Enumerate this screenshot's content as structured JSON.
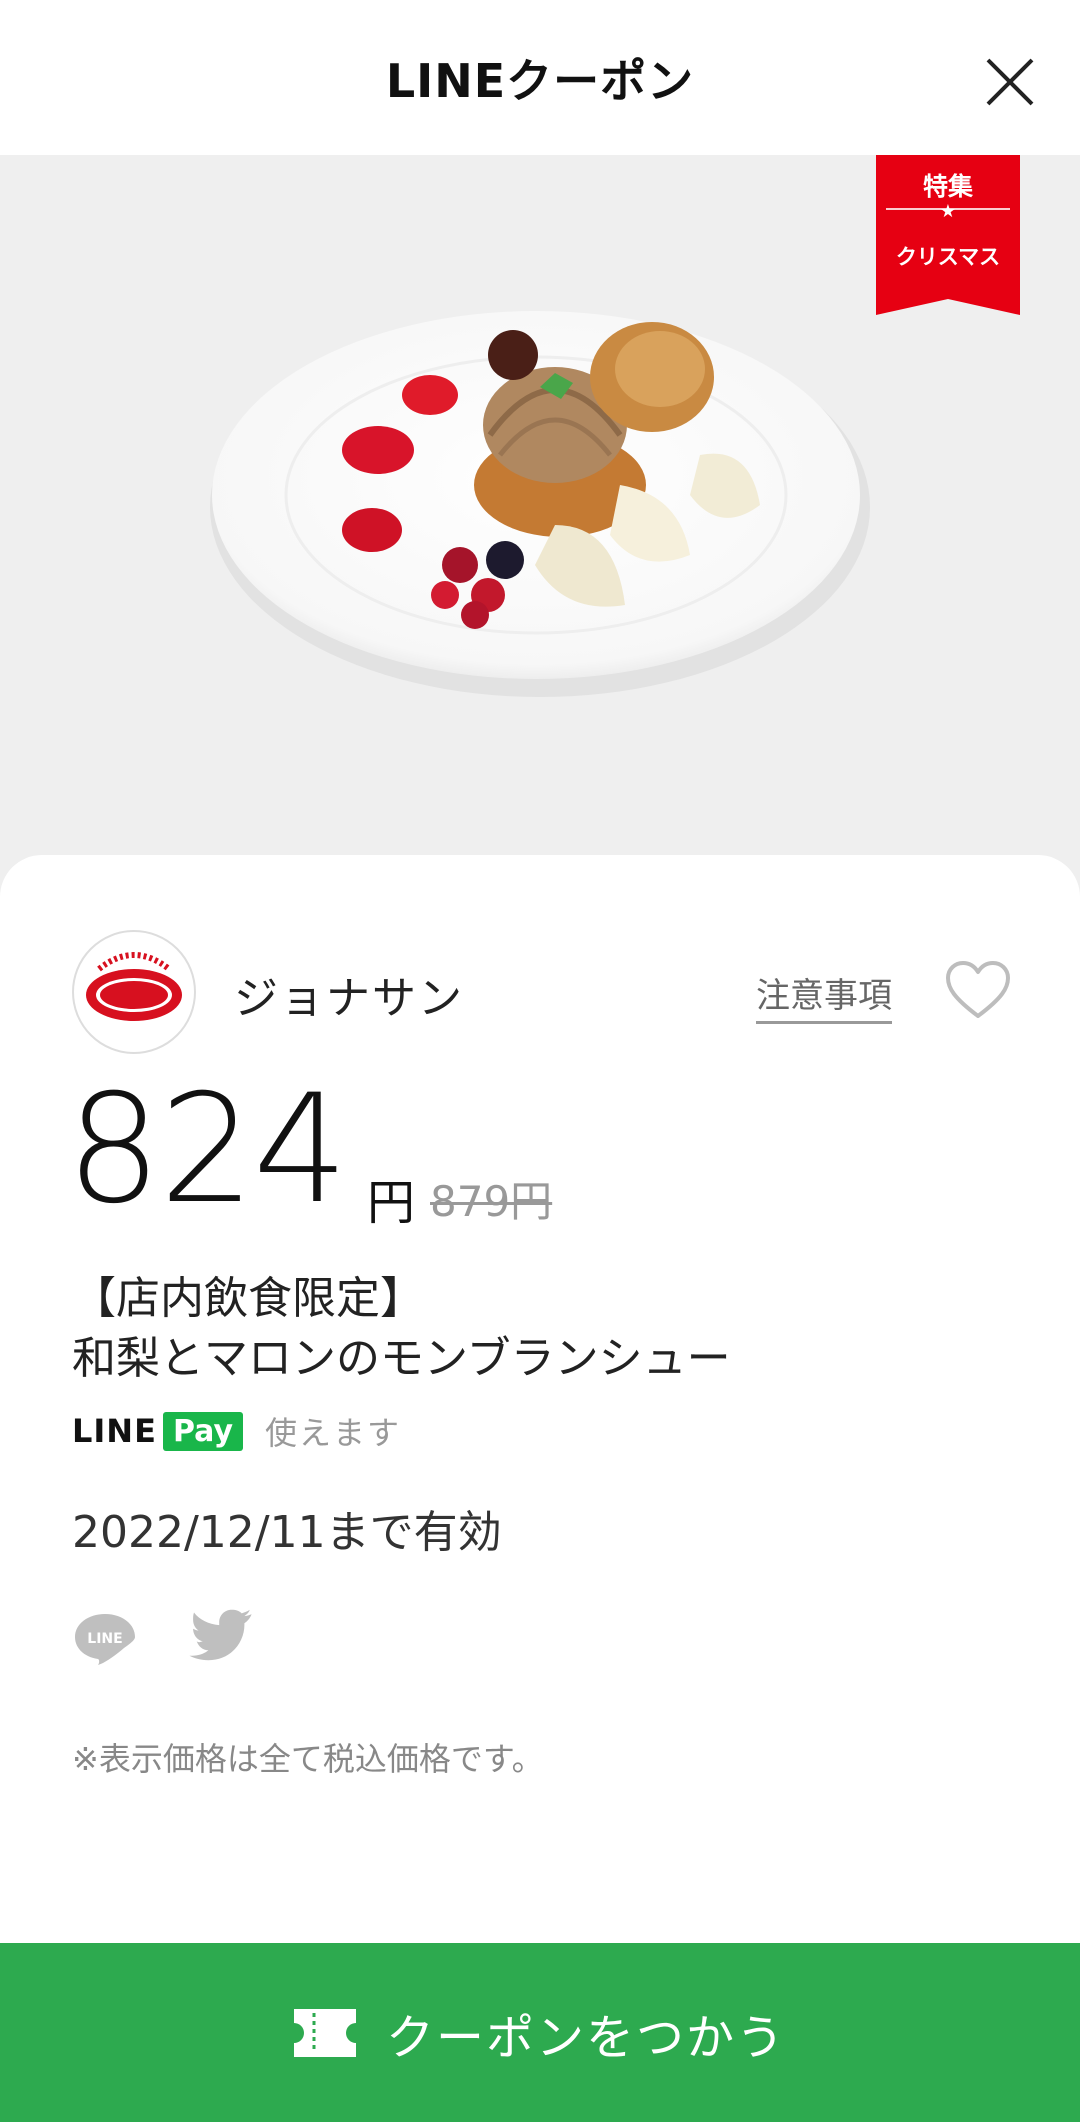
{
  "header": {
    "title": "LINEクーポン"
  },
  "hero": {
    "ribbon_top": "特集",
    "ribbon_bottom": "クリスマス"
  },
  "shop": {
    "name": "ジョナサン",
    "notes_label": "注意事項"
  },
  "price": {
    "value": "824",
    "unit": "円",
    "original": "879円"
  },
  "item": {
    "line1": "【店内飲食限定】",
    "line2": "和梨とマロンのモンブランシュー"
  },
  "linepay": {
    "line": "LINE",
    "pay": "Pay",
    "usable": "使えます"
  },
  "valid_until": "2022/12/11まで有効",
  "tax_note": "※表示価格は全て税込価格です。",
  "cta": {
    "label": "クーポンをつかう"
  },
  "colors": {
    "accent": "#2daa4f",
    "ribbon": "#e60012",
    "linepay": "#19b64a"
  }
}
